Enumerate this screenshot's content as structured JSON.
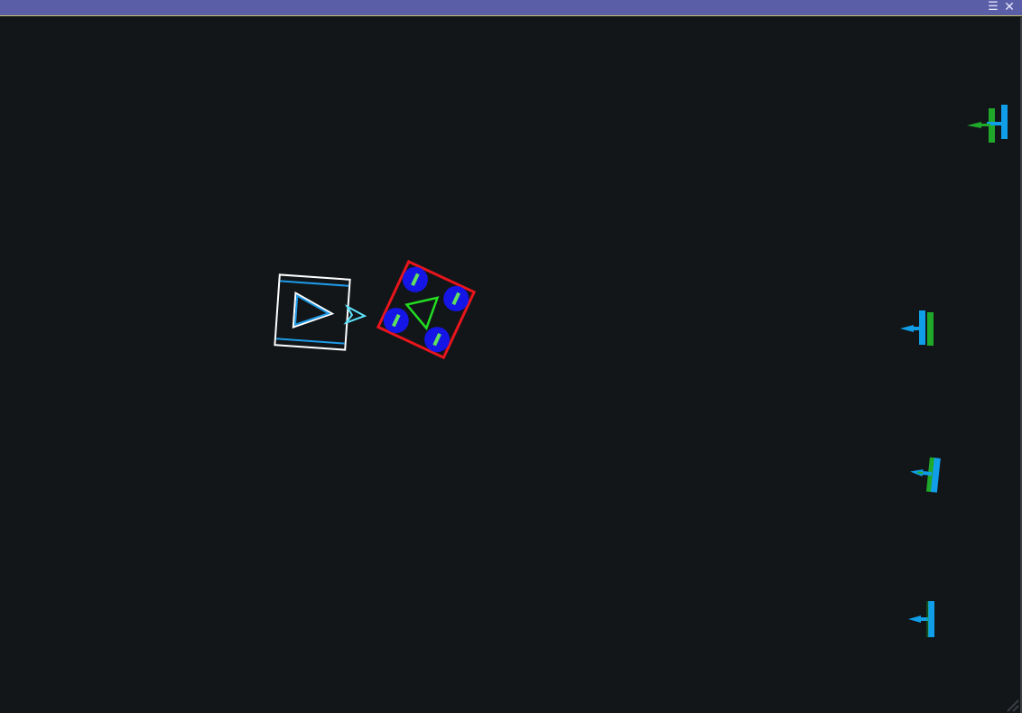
{
  "window": {
    "title": "",
    "menu_icon": "menu-icon",
    "close_icon": "close-icon",
    "menu_glyph": "☰",
    "close_glyph": "✕"
  },
  "colors": {
    "titlebar": "#5a5ea6",
    "background": "#121619",
    "player_frame": "#ffffff",
    "player_inner": "#1e9be8",
    "player_marker": "#5ee6ff",
    "robot_frame": "#e8151c",
    "robot_wheel": "#1515e6",
    "robot_tread": "#5fe05f",
    "robot_heading": "#22dd22",
    "enemy_blue": "#109ee8",
    "enemy_green": "#1fa82a"
  },
  "scene": {
    "player": {
      "shape": "square-with-direction-triangle"
    },
    "robot": {
      "shape": "four-wheel-drive-square",
      "wheels": 4
    },
    "enemies": [
      {
        "id": "enemy-1",
        "shape": "turret"
      },
      {
        "id": "enemy-2",
        "shape": "turret"
      },
      {
        "id": "enemy-3",
        "shape": "turret"
      },
      {
        "id": "enemy-4",
        "shape": "turret"
      }
    ]
  }
}
